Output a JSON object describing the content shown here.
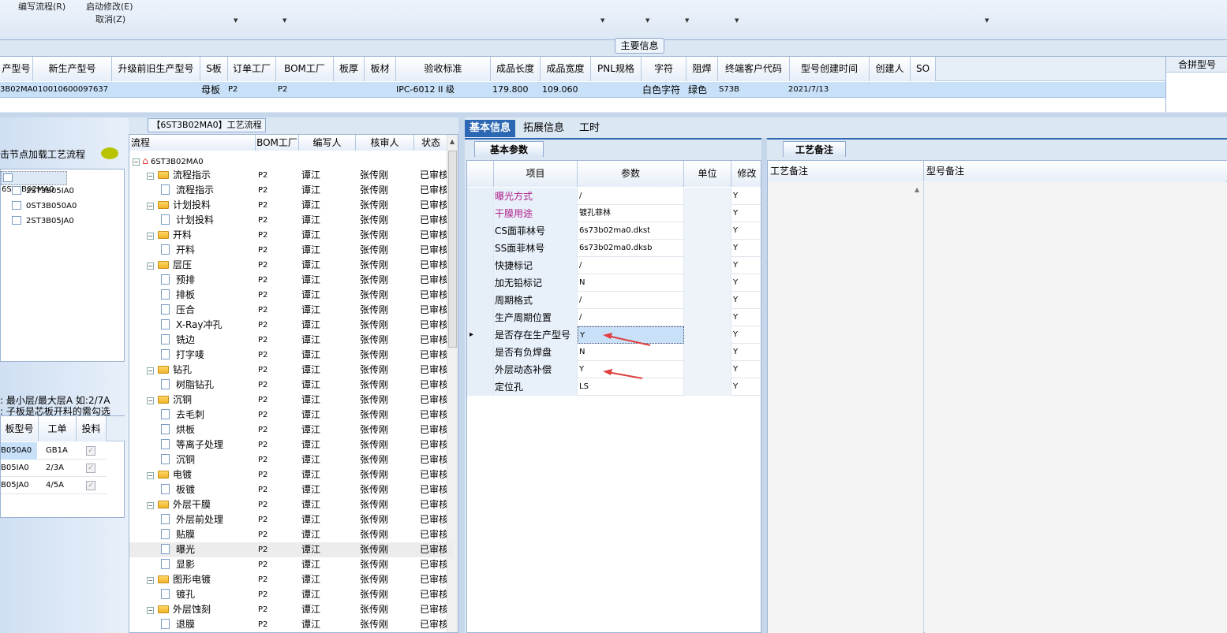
{
  "menu": {
    "write_flow": "编写流程(R)",
    "start_modify": "启动修改(E)",
    "cancel": "取消(Z)"
  },
  "main_info_label": "主要信息",
  "main_table": {
    "headers": [
      "产型号",
      "新生产型号",
      "升级前旧生产型号",
      "S板",
      "订单工厂",
      "BOM工厂",
      "板厚",
      "板材",
      "验收标准",
      "成品长度",
      "成品宽度",
      "PNL规格",
      "字符",
      "阻焊",
      "终端客户代码",
      "型号创建时间",
      "创建人",
      "SO"
    ],
    "row": [
      "3B02MA0",
      "10010600097637",
      "",
      "母板",
      "P2",
      "P2",
      "",
      "",
      "IPC-6012 II 级",
      "179.800",
      "109.060",
      "",
      "白色字符",
      "绿色",
      "S73B",
      "2021/7/13",
      "",
      ""
    ],
    "right_header": "合拼型号"
  },
  "left": {
    "hint": "击节点加载工艺流程",
    "tree": [
      "6ST3B02MA0",
      "2ST3B05IA0",
      "0ST3B050A0",
      "2ST3B05JA0"
    ],
    "notes": [
      ": 最小层/最大层A 如:2/7A",
      ": 子板是芯板开料的需勾选"
    ],
    "table_headers": [
      "板型号",
      "工单",
      "投料"
    ],
    "rows": [
      [
        "B050A0",
        "GB1A"
      ],
      [
        "B05IA0",
        "2/3A"
      ],
      [
        "B05JA0",
        "4/5A"
      ]
    ]
  },
  "flow": {
    "title": "【6ST3B02MA0】工艺流程",
    "headers": [
      "流程",
      "BOM工厂",
      "编写人",
      "核审人",
      "状态"
    ],
    "root": "6ST3B02MA0",
    "rows": [
      {
        "name": "流程指示",
        "type": "folder",
        "bom": "P2",
        "writer": "谭江",
        "reviewer": "张传刚",
        "status": "已审核"
      },
      {
        "name": "流程指示",
        "type": "doc",
        "bom": "P2",
        "writer": "谭江",
        "reviewer": "张传刚",
        "status": "已审核"
      },
      {
        "name": "计划投料",
        "type": "folder",
        "bom": "P2",
        "writer": "谭江",
        "reviewer": "张传刚",
        "status": "已审核"
      },
      {
        "name": "计划投料",
        "type": "doc",
        "bom": "P2",
        "writer": "谭江",
        "reviewer": "张传刚",
        "status": "已审核"
      },
      {
        "name": "开料",
        "type": "folder",
        "bom": "P2",
        "writer": "谭江",
        "reviewer": "张传刚",
        "status": "已审核"
      },
      {
        "name": "开料",
        "type": "doc",
        "bom": "P2",
        "writer": "谭江",
        "reviewer": "张传刚",
        "status": "已审核"
      },
      {
        "name": "层压",
        "type": "folder",
        "bom": "P2",
        "writer": "谭江",
        "reviewer": "张传刚",
        "status": "已审核"
      },
      {
        "name": "预排",
        "type": "doc",
        "bom": "P2",
        "writer": "谭江",
        "reviewer": "张传刚",
        "status": "已审核"
      },
      {
        "name": "排板",
        "type": "doc",
        "bom": "P2",
        "writer": "谭江",
        "reviewer": "张传刚",
        "status": "已审核"
      },
      {
        "name": "压合",
        "type": "doc",
        "bom": "P2",
        "writer": "谭江",
        "reviewer": "张传刚",
        "status": "已审核"
      },
      {
        "name": "X-Ray冲孔",
        "type": "doc",
        "bom": "P2",
        "writer": "谭江",
        "reviewer": "张传刚",
        "status": "已审核"
      },
      {
        "name": "铣边",
        "type": "doc",
        "bom": "P2",
        "writer": "谭江",
        "reviewer": "张传刚",
        "status": "已审核"
      },
      {
        "name": "打字唛",
        "type": "doc",
        "bom": "P2",
        "writer": "谭江",
        "reviewer": "张传刚",
        "status": "已审核"
      },
      {
        "name": "钻孔",
        "type": "folder",
        "bom": "P2",
        "writer": "谭江",
        "reviewer": "张传刚",
        "status": "已审核"
      },
      {
        "name": "树脂钻孔",
        "type": "doc",
        "bom": "P2",
        "writer": "谭江",
        "reviewer": "张传刚",
        "status": "已审核"
      },
      {
        "name": "沉铜",
        "type": "folder",
        "bom": "P2",
        "writer": "谭江",
        "reviewer": "张传刚",
        "status": "已审核"
      },
      {
        "name": "去毛刺",
        "type": "doc",
        "bom": "P2",
        "writer": "谭江",
        "reviewer": "张传刚",
        "status": "已审核"
      },
      {
        "name": "烘板",
        "type": "doc",
        "bom": "P2",
        "writer": "谭江",
        "reviewer": "张传刚",
        "status": "已审核"
      },
      {
        "name": "等离子处理",
        "type": "doc",
        "bom": "P2",
        "writer": "谭江",
        "reviewer": "张传刚",
        "status": "已审核"
      },
      {
        "name": "沉铜",
        "type": "doc",
        "bom": "P2",
        "writer": "谭江",
        "reviewer": "张传刚",
        "status": "已审核"
      },
      {
        "name": "电镀",
        "type": "folder",
        "bom": "P2",
        "writer": "谭江",
        "reviewer": "张传刚",
        "status": "已审核"
      },
      {
        "name": "板镀",
        "type": "doc",
        "bom": "P2",
        "writer": "谭江",
        "reviewer": "张传刚",
        "status": "已审核"
      },
      {
        "name": "外层干膜",
        "type": "folder",
        "bom": "P2",
        "writer": "谭江",
        "reviewer": "张传刚",
        "status": "已审核"
      },
      {
        "name": "外层前处理",
        "type": "doc",
        "bom": "P2",
        "writer": "谭江",
        "reviewer": "张传刚",
        "status": "已审核"
      },
      {
        "name": "贴膜",
        "type": "doc",
        "bom": "P2",
        "writer": "谭江",
        "reviewer": "张传刚",
        "status": "已审核"
      },
      {
        "name": "曝光",
        "type": "doc",
        "bom": "P2",
        "writer": "谭江",
        "reviewer": "张传刚",
        "status": "已审核"
      },
      {
        "name": "显影",
        "type": "doc",
        "bom": "P2",
        "writer": "谭江",
        "reviewer": "张传刚",
        "status": "已审核"
      },
      {
        "name": "图形电镀",
        "type": "folder",
        "bom": "P2",
        "writer": "谭江",
        "reviewer": "张传刚",
        "status": "已审核"
      },
      {
        "name": "镀孔",
        "type": "doc",
        "bom": "P2",
        "writer": "谭江",
        "reviewer": "张传刚",
        "status": "已审核"
      },
      {
        "name": "外层蚀刻",
        "type": "folder",
        "bom": "P2",
        "writer": "谭江",
        "reviewer": "张传刚",
        "status": "已审核"
      },
      {
        "name": "退膜",
        "type": "doc",
        "bom": "P2",
        "writer": "谭江",
        "reviewer": "张传刚",
        "status": "已审核"
      }
    ]
  },
  "info": {
    "tabs": [
      "基本信息",
      "拓展信息",
      "工时"
    ],
    "subtab": "基本参数",
    "headers": [
      "项目",
      "参数",
      "单位",
      "修改"
    ],
    "rows": [
      {
        "item": "曝光方式",
        "param": "/",
        "unit": "",
        "mod": "Y",
        "pink": true
      },
      {
        "item": "干膜用途",
        "param": "镀孔菲林",
        "unit": "",
        "mod": "Y",
        "pink": true
      },
      {
        "item": "CS面菲林号",
        "param": "6s73b02ma0.dkst",
        "unit": "",
        "mod": "Y",
        "pink": false
      },
      {
        "item": "SS面菲林号",
        "param": "6s73b02ma0.dksb",
        "unit": "",
        "mod": "Y",
        "pink": false
      },
      {
        "item": "快捷标记",
        "param": "/",
        "unit": "",
        "mod": "Y",
        "pink": false
      },
      {
        "item": "加无铅标记",
        "param": "N",
        "unit": "",
        "mod": "Y",
        "pink": false
      },
      {
        "item": "周期格式",
        "param": "/",
        "unit": "",
        "mod": "Y",
        "pink": false
      },
      {
        "item": "生产周期位置",
        "param": "/",
        "unit": "",
        "mod": "Y",
        "pink": false
      },
      {
        "item": "是否存在生产型号",
        "param": "Y",
        "unit": "",
        "mod": "Y",
        "pink": false
      },
      {
        "item": "是否有负焊盘",
        "param": "N",
        "unit": "",
        "mod": "Y",
        "pink": false
      },
      {
        "item": "外层动态补偿",
        "param": "Y",
        "unit": "",
        "mod": "Y",
        "pink": false
      },
      {
        "item": "定位孔",
        "param": "LS",
        "unit": "",
        "mod": "Y",
        "pink": false
      }
    ]
  },
  "remark": {
    "tab": "工艺备注",
    "headers": [
      "工艺备注",
      "型号备注"
    ]
  },
  "colors": {
    "selected_row": "#c8e1f9",
    "header_bg": "#e6eef8",
    "tab_active": "#2b67b3",
    "pink_text": "#b0208a",
    "arrow": "#e04040"
  }
}
